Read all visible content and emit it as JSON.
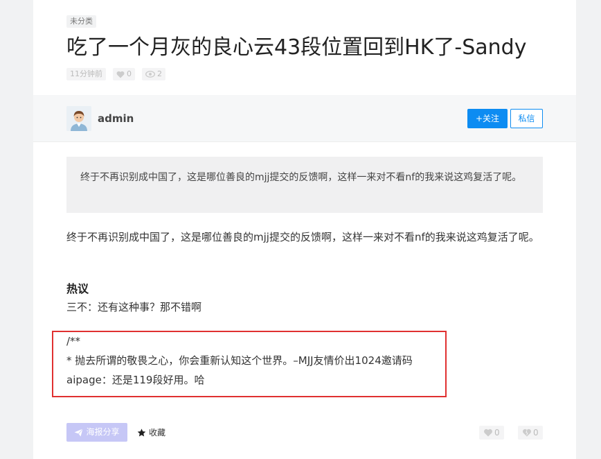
{
  "post": {
    "category": "未分类",
    "title": "吃了一个月灰的良心云43段位置回到HK了-Sandy",
    "time": "11分钟前",
    "likes": "0",
    "views": "2"
  },
  "author": {
    "name": "admin",
    "follow_label": "+关注",
    "message_label": "私信"
  },
  "content": {
    "excerpt": "终于不再识别成中国了，这是哪位善良的mjj提交的反馈啊，这样一来对不看nf的我来说这鸡复活了呢。",
    "paragraph": "终于不再识别成中国了，这是哪位善良的mjj提交的反馈啊，这样一来对不看nf的我来说这鸡复活了呢。",
    "hot_title": "热议",
    "hot_text": "三不：还有这种事？那不错啊",
    "code_line1": "/**",
    "code_line2": "* 抛去所谓的敬畏之心，你会重新认知这个世界。–MJJ友情价出1024邀请码",
    "code_line3": "aipage：还是119段好用。哈"
  },
  "footer": {
    "share_label": "海报分享",
    "collect_label": "收藏",
    "like_count": "0",
    "dislike_count": "0"
  },
  "colors": {
    "accent": "#0d8cf2",
    "highlight_border": "#e03030",
    "share_button": "#c6c7f6"
  },
  "icons": {
    "meta_like": "heart-icon",
    "meta_views": "eye-icon",
    "share": "paper-plane-icon",
    "collect": "star-icon",
    "like": "heart-icon",
    "dislike": "broken-heart-icon"
  }
}
